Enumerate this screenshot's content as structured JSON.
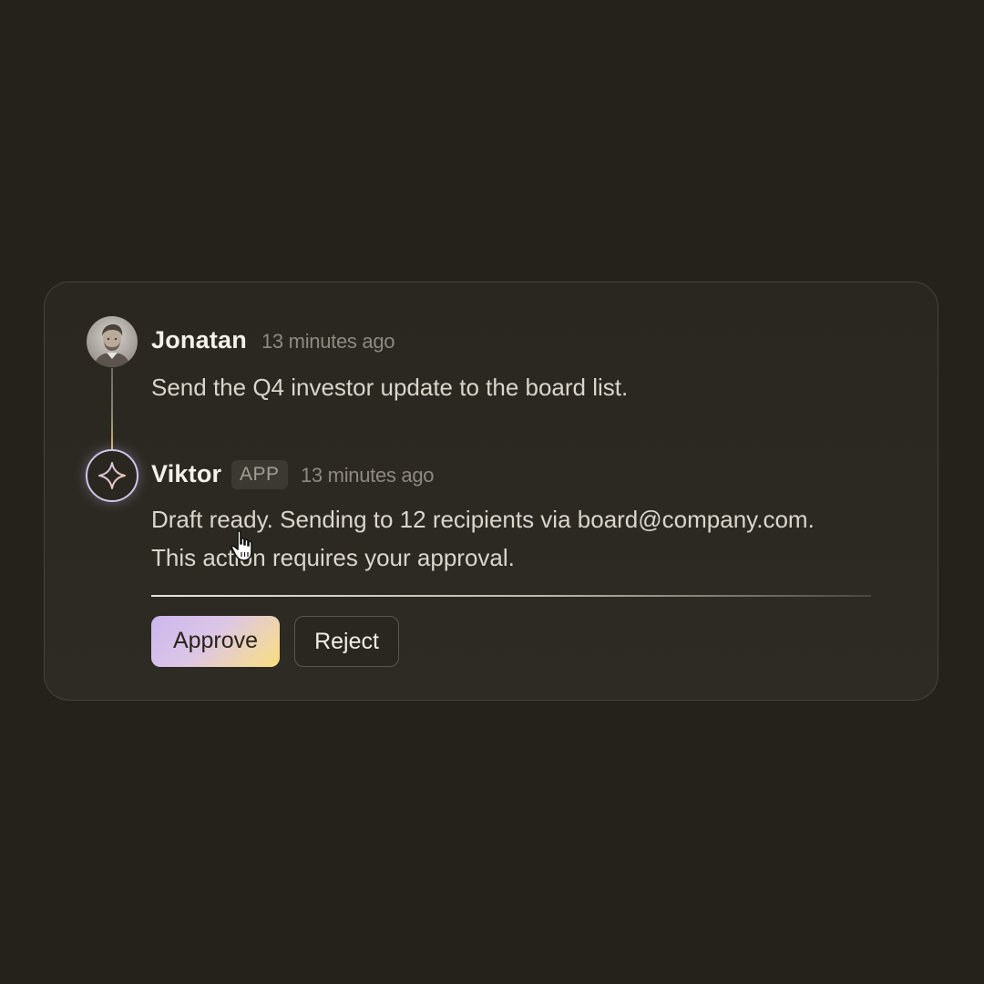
{
  "messages": [
    {
      "author": "Jonatan",
      "time": "13 minutes ago",
      "text": "Send the Q4 investor update to the board list.",
      "avatar_icon": "person-photo"
    },
    {
      "author": "Viktor",
      "badge": "APP",
      "time": "13 minutes ago",
      "text_line1": "Draft ready. Sending to 12 recipients via board@company.com.",
      "text_line2": "This action requires your approval.",
      "avatar_icon": "sparkle-icon"
    }
  ],
  "actions": {
    "approve_label": "Approve",
    "reject_label": "Reject"
  },
  "colors": {
    "background": "#25221c",
    "approve_gradient_start": "#cbb7ee",
    "approve_gradient_end": "#f6dd7e",
    "bot_ring": "#cfc4ea"
  }
}
